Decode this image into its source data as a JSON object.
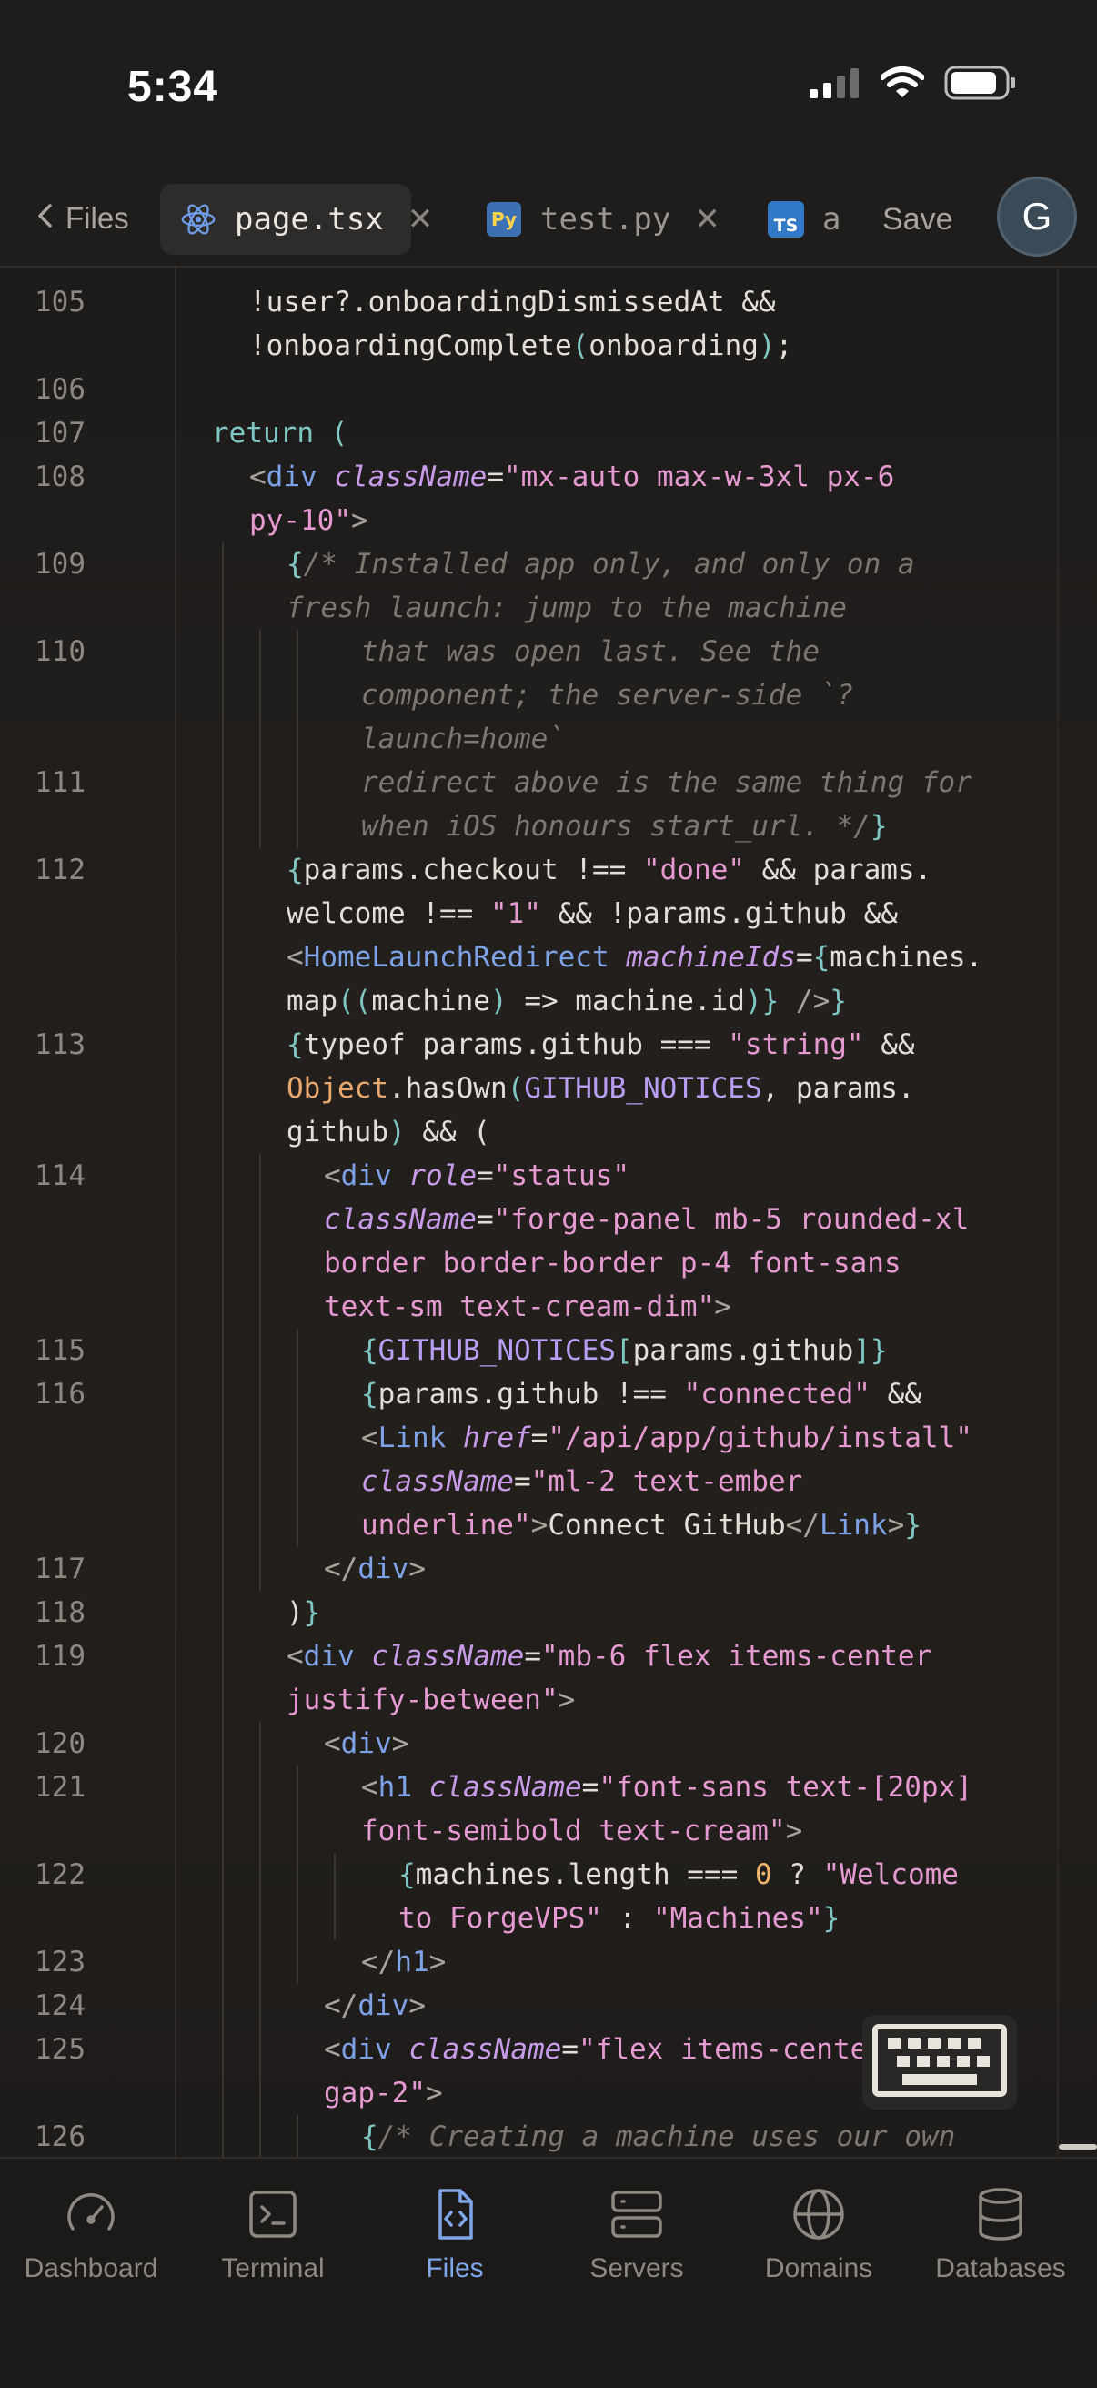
{
  "status_bar": {
    "time": "5:34"
  },
  "tabs": {
    "back_label": "Files",
    "items": [
      {
        "label": "page.tsx",
        "icon": "react-icon",
        "active": true
      },
      {
        "label": "test.py",
        "icon": "python-icon",
        "active": false
      },
      {
        "label": "a",
        "icon": "typescript-icon",
        "active": false
      }
    ],
    "py_badge": "Py",
    "ts_badge": "TS",
    "close_glyph": "✕",
    "save_label": "Save",
    "avatar_initial": "G"
  },
  "editor": {
    "lines": [
      {
        "n": "105",
        "indent": 1,
        "segs": [
          [
            "p",
            "!user?.onboardingDismissedAt &&"
          ]
        ]
      },
      {
        "n": "",
        "indent": 1,
        "segs": [
          [
            "p",
            "!onboardingComplete"
          ],
          [
            "kw",
            "("
          ],
          [
            "p",
            "onboarding"
          ],
          [
            "kw",
            ")"
          ],
          [
            "p",
            ";"
          ]
        ]
      },
      {
        "n": "106",
        "indent": 0,
        "segs": []
      },
      {
        "n": "107",
        "indent": 0,
        "segs": [
          [
            "kw",
            "return ("
          ]
        ]
      },
      {
        "n": "108",
        "indent": 1,
        "segs": [
          [
            "punc",
            "<"
          ],
          [
            "tag",
            "div"
          ],
          [
            "p",
            " "
          ],
          [
            "attr",
            "className"
          ],
          [
            "p",
            "="
          ],
          [
            "str",
            "\"mx-auto max-w-3xl px-6"
          ]
        ]
      },
      {
        "n": "",
        "indent": 1,
        "segs": [
          [
            "str",
            "py-10\""
          ],
          [
            "punc",
            ">"
          ]
        ]
      },
      {
        "n": "109",
        "indent": 2,
        "segs": [
          [
            "kw",
            "{"
          ],
          [
            "cmt",
            "/* Installed app only, and only on a"
          ]
        ]
      },
      {
        "n": "",
        "indent": 2,
        "segs": [
          [
            "cmt",
            "fresh launch: jump to the machine"
          ]
        ]
      },
      {
        "n": "110",
        "indent": 4,
        "segs": [
          [
            "cmt",
            "that was open last. See the"
          ]
        ]
      },
      {
        "n": "",
        "indent": 4,
        "segs": [
          [
            "cmt",
            "component; the server-side `?"
          ]
        ]
      },
      {
        "n": "",
        "indent": 4,
        "segs": [
          [
            "cmt",
            "launch=home`"
          ]
        ]
      },
      {
        "n": "111",
        "indent": 4,
        "segs": [
          [
            "cmt",
            "redirect above is the same thing for"
          ]
        ]
      },
      {
        "n": "",
        "indent": 4,
        "segs": [
          [
            "cmt",
            "when iOS honours start_url. */"
          ],
          [
            "kw",
            "}"
          ]
        ]
      },
      {
        "n": "112",
        "indent": 2,
        "segs": [
          [
            "kw",
            "{"
          ],
          [
            "p",
            "params.checkout !== "
          ],
          [
            "str",
            "\"done\""
          ],
          [
            "p",
            " && params."
          ]
        ]
      },
      {
        "n": "",
        "indent": 2,
        "segs": [
          [
            "p",
            "welcome !== "
          ],
          [
            "str",
            "\"1\""
          ],
          [
            "p",
            " && !params.github &&"
          ]
        ]
      },
      {
        "n": "",
        "indent": 2,
        "segs": [
          [
            "punc",
            "<"
          ],
          [
            "tag",
            "HomeLaunchRedirect"
          ],
          [
            "p",
            " "
          ],
          [
            "attr",
            "machineIds"
          ],
          [
            "p",
            "="
          ],
          [
            "kw",
            "{"
          ],
          [
            "p",
            "machines."
          ]
        ]
      },
      {
        "n": "",
        "indent": 2,
        "segs": [
          [
            "p",
            "map"
          ],
          [
            "kw",
            "(("
          ],
          [
            "p",
            "machine"
          ],
          [
            "kw",
            ")"
          ],
          [
            "p",
            " => machine.id"
          ],
          [
            "kw",
            ")}"
          ],
          [
            "p",
            " "
          ],
          [
            "punc",
            "/>"
          ],
          [
            "kw",
            "}"
          ]
        ]
      },
      {
        "n": "113",
        "indent": 2,
        "segs": [
          [
            "kw",
            "{"
          ],
          [
            "p",
            "typeof params.github === "
          ],
          [
            "str",
            "\"string\""
          ],
          [
            "p",
            " &&"
          ]
        ]
      },
      {
        "n": "",
        "indent": 2,
        "segs": [
          [
            "obj",
            "Object"
          ],
          [
            "p",
            ".hasOwn"
          ],
          [
            "kw",
            "("
          ],
          [
            "const",
            "GITHUB_NOTICES"
          ],
          [
            "p",
            ", params."
          ]
        ]
      },
      {
        "n": "",
        "indent": 2,
        "segs": [
          [
            "p",
            "github"
          ],
          [
            "kw",
            ")"
          ],
          [
            "p",
            " && ("
          ]
        ]
      },
      {
        "n": "114",
        "indent": 3,
        "segs": [
          [
            "punc",
            "<"
          ],
          [
            "tag",
            "div"
          ],
          [
            "p",
            " "
          ],
          [
            "attr",
            "role"
          ],
          [
            "p",
            "="
          ],
          [
            "str",
            "\"status\""
          ]
        ]
      },
      {
        "n": "",
        "indent": 3,
        "segs": [
          [
            "attr",
            "className"
          ],
          [
            "p",
            "="
          ],
          [
            "str",
            "\"forge-panel mb-5 rounded-xl"
          ]
        ]
      },
      {
        "n": "",
        "indent": 3,
        "segs": [
          [
            "str",
            "border border-border p-4 font-sans"
          ]
        ]
      },
      {
        "n": "",
        "indent": 3,
        "segs": [
          [
            "str",
            "text-sm text-cream-dim\""
          ],
          [
            "punc",
            ">"
          ]
        ]
      },
      {
        "n": "115",
        "indent": 4,
        "segs": [
          [
            "kw",
            "{"
          ],
          [
            "const",
            "GITHUB_NOTICES"
          ],
          [
            "kw",
            "["
          ],
          [
            "p",
            "params.github"
          ],
          [
            "kw",
            "]}"
          ]
        ]
      },
      {
        "n": "116",
        "indent": 4,
        "segs": [
          [
            "kw",
            "{"
          ],
          [
            "p",
            "params.github !== "
          ],
          [
            "str",
            "\"connected\""
          ],
          [
            "p",
            " &&"
          ]
        ]
      },
      {
        "n": "",
        "indent": 4,
        "segs": [
          [
            "punc",
            "<"
          ],
          [
            "tag",
            "Link"
          ],
          [
            "p",
            " "
          ],
          [
            "attr",
            "href"
          ],
          [
            "p",
            "="
          ],
          [
            "str",
            "\"/api/app/github/install\""
          ]
        ]
      },
      {
        "n": "",
        "indent": 4,
        "segs": [
          [
            "attr",
            "className"
          ],
          [
            "p",
            "="
          ],
          [
            "str",
            "\"ml-2 text-ember"
          ]
        ]
      },
      {
        "n": "",
        "indent": 4,
        "segs": [
          [
            "str",
            "underline\""
          ],
          [
            "punc",
            ">"
          ],
          [
            "p",
            "Connect GitHub"
          ],
          [
            "punc",
            "</"
          ],
          [
            "tag",
            "Link"
          ],
          [
            "punc",
            ">"
          ],
          [
            "kw",
            "}"
          ]
        ]
      },
      {
        "n": "117",
        "indent": 3,
        "segs": [
          [
            "punc",
            "</"
          ],
          [
            "tag",
            "div"
          ],
          [
            "punc",
            ">"
          ]
        ]
      },
      {
        "n": "118",
        "indent": 2,
        "segs": [
          [
            "p",
            ")"
          ],
          [
            "kw",
            "}"
          ]
        ]
      },
      {
        "n": "119",
        "indent": 2,
        "segs": [
          [
            "punc",
            "<"
          ],
          [
            "tag",
            "div"
          ],
          [
            "p",
            " "
          ],
          [
            "attr",
            "className"
          ],
          [
            "p",
            "="
          ],
          [
            "str",
            "\"mb-6 flex items-center"
          ]
        ]
      },
      {
        "n": "",
        "indent": 2,
        "segs": [
          [
            "str",
            "justify-between\""
          ],
          [
            "punc",
            ">"
          ]
        ]
      },
      {
        "n": "120",
        "indent": 3,
        "segs": [
          [
            "punc",
            "<"
          ],
          [
            "tag",
            "div"
          ],
          [
            "punc",
            ">"
          ]
        ]
      },
      {
        "n": "121",
        "indent": 4,
        "segs": [
          [
            "punc",
            "<"
          ],
          [
            "tag",
            "h1"
          ],
          [
            "p",
            " "
          ],
          [
            "attr",
            "className"
          ],
          [
            "p",
            "="
          ],
          [
            "str",
            "\"font-sans text-[20px]"
          ]
        ]
      },
      {
        "n": "",
        "indent": 4,
        "segs": [
          [
            "str",
            "font-semibold text-cream\""
          ],
          [
            "punc",
            ">"
          ]
        ]
      },
      {
        "n": "122",
        "indent": 5,
        "segs": [
          [
            "kw",
            "{"
          ],
          [
            "p",
            "machines.length === "
          ],
          [
            "num",
            "0"
          ],
          [
            "p",
            " ? "
          ],
          [
            "str",
            "\"Welcome"
          ]
        ]
      },
      {
        "n": "",
        "indent": 5,
        "segs": [
          [
            "str",
            "to ForgeVPS\""
          ],
          [
            "p",
            " : "
          ],
          [
            "str",
            "\"Machines\""
          ],
          [
            "kw",
            "}"
          ]
        ]
      },
      {
        "n": "123",
        "indent": 4,
        "segs": [
          [
            "punc",
            "</"
          ],
          [
            "tag",
            "h1"
          ],
          [
            "punc",
            ">"
          ]
        ]
      },
      {
        "n": "124",
        "indent": 3,
        "segs": [
          [
            "punc",
            "</"
          ],
          [
            "tag",
            "div"
          ],
          [
            "punc",
            ">"
          ]
        ]
      },
      {
        "n": "125",
        "indent": 3,
        "segs": [
          [
            "punc",
            "<"
          ],
          [
            "tag",
            "div"
          ],
          [
            "p",
            " "
          ],
          [
            "attr",
            "className"
          ],
          [
            "p",
            "="
          ],
          [
            "str",
            "\"flex items-center"
          ]
        ]
      },
      {
        "n": "",
        "indent": 3,
        "segs": [
          [
            "str",
            "gap-2\""
          ],
          [
            "punc",
            ">"
          ]
        ]
      },
      {
        "n": "126",
        "indent": 4,
        "segs": [
          [
            "kw",
            "{"
          ],
          [
            "cmt",
            "/* Creating a machine uses our own"
          ]
        ]
      }
    ]
  },
  "bottom_nav": {
    "items": [
      {
        "label": "Dashboard",
        "icon": "gauge-icon",
        "active": false
      },
      {
        "label": "Terminal",
        "icon": "terminal-icon",
        "active": false
      },
      {
        "label": "Files",
        "icon": "file-code-icon",
        "active": true
      },
      {
        "label": "Servers",
        "icon": "server-icon",
        "active": false
      },
      {
        "label": "Domains",
        "icon": "globe-icon",
        "active": false
      },
      {
        "label": "Databases",
        "icon": "database-icon",
        "active": false
      }
    ]
  },
  "colors": {
    "accent": "#7ea6e8",
    "string": "#e59ad2",
    "keyword": "#7fc7c4",
    "tag": "#7da2e6",
    "attribute": "#c79be8",
    "comment": "#7c776f",
    "number": "#f2b56b"
  }
}
